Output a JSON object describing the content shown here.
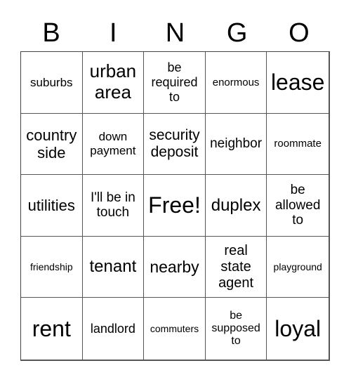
{
  "header": {
    "letters": [
      "B",
      "I",
      "N",
      "G",
      "O"
    ]
  },
  "card": {
    "rows": [
      [
        {
          "text": "suburbs",
          "size": "s17"
        },
        {
          "text": "urban\narea",
          "size": "s26"
        },
        {
          "text": "be\nrequired\nto",
          "size": "s18"
        },
        {
          "text": "enormous",
          "size": "s15"
        },
        {
          "text": "lease",
          "size": "s32"
        }
      ],
      [
        {
          "text": "country\nside",
          "size": "s22"
        },
        {
          "text": "down\npayment",
          "size": "s17"
        },
        {
          "text": "security\ndeposit",
          "size": "s21"
        },
        {
          "text": "neighbor",
          "size": "s19"
        },
        {
          "text": "roommate",
          "size": "s15"
        }
      ],
      [
        {
          "text": "utilities",
          "size": "s22"
        },
        {
          "text": "I'll be in\ntouch",
          "size": "s19"
        },
        {
          "text": "Free!",
          "size": "s32",
          "free": true
        },
        {
          "text": "duplex",
          "size": "s24"
        },
        {
          "text": "be\nallowed\nto",
          "size": "s19"
        }
      ],
      [
        {
          "text": "friendship",
          "size": "s14"
        },
        {
          "text": "tenant",
          "size": "s24"
        },
        {
          "text": "nearby",
          "size": "s23"
        },
        {
          "text": "real\nstate\nagent",
          "size": "s20"
        },
        {
          "text": "playground",
          "size": "s14"
        }
      ],
      [
        {
          "text": "rent",
          "size": "s32"
        },
        {
          "text": "landlord",
          "size": "s18"
        },
        {
          "text": "commuters",
          "size": "s14"
        },
        {
          "text": "be\nsupposed\nto",
          "size": "s16"
        },
        {
          "text": "loyal",
          "size": "s32"
        }
      ]
    ]
  }
}
